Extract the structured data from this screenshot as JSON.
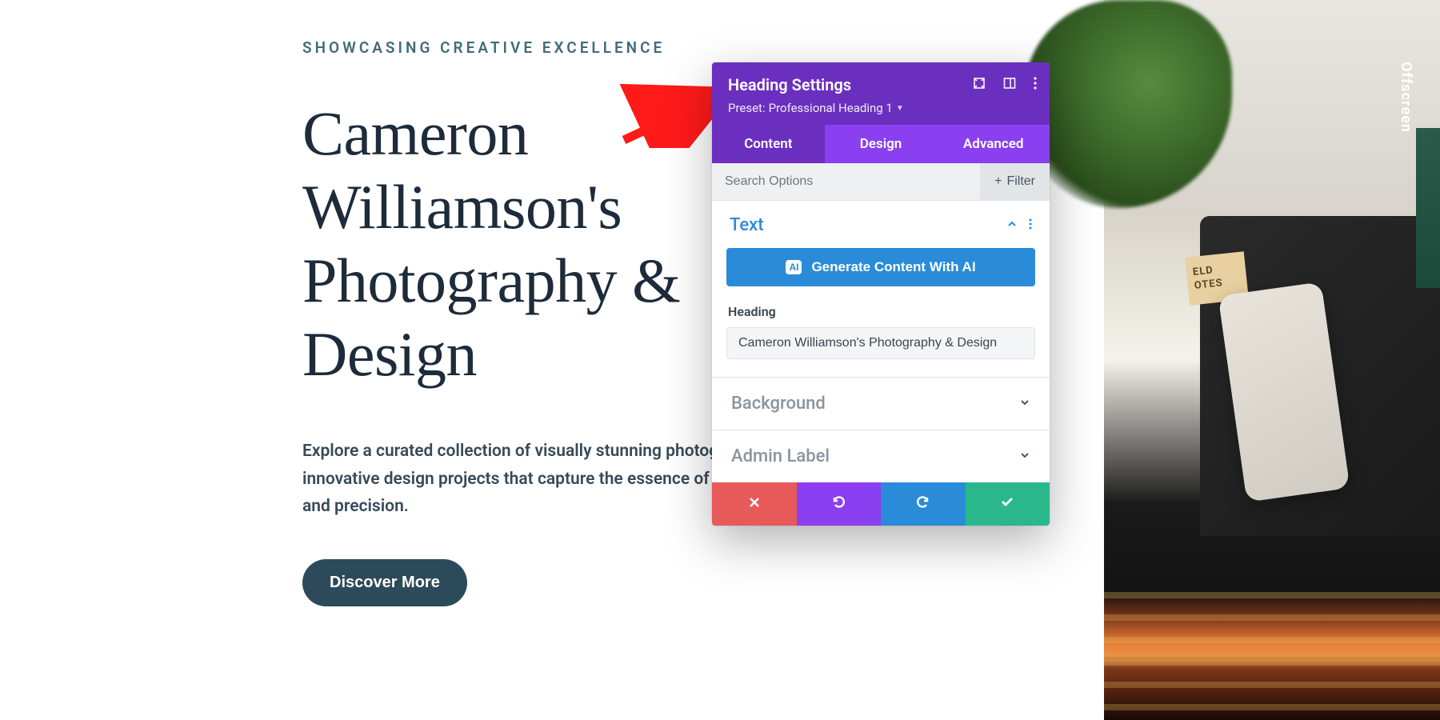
{
  "page": {
    "kicker": "SHOWCASING CREATIVE EXCELLENCE",
    "title": "Cameron Williamson's Photography & Design",
    "body": "Explore a curated collection of visually stunning photographs and innovative design projects that capture the essence of creativity and precision.",
    "cta": "Discover More"
  },
  "bg": {
    "notebook_line1": "ELD",
    "notebook_line2": "OTES",
    "side_text": "Offscreen"
  },
  "panel": {
    "title": "Heading Settings",
    "preset_prefix": "Preset: ",
    "preset_name": "Professional Heading 1",
    "tabs": {
      "content": "Content",
      "design": "Design",
      "advanced": "Advanced"
    },
    "search_placeholder": "Search Options",
    "filter_label": "Filter",
    "text_section": {
      "title": "Text",
      "ai_button": "Generate Content With AI",
      "ai_badge": "AI",
      "heading_label": "Heading",
      "heading_value": "Cameron Williamson's Photography & Design"
    },
    "background_section": "Background",
    "admin_section": "Admin Label"
  }
}
